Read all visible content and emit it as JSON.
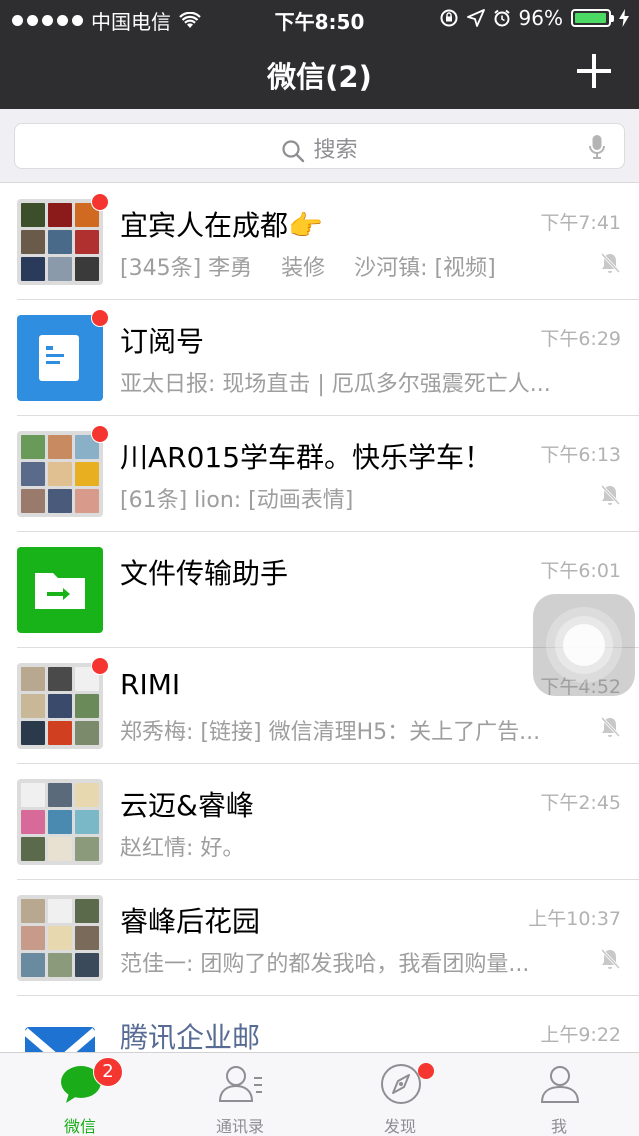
{
  "status_bar": {
    "carrier": "中国电信",
    "time": "下午8:50",
    "battery": "96%",
    "battery_level": 0.96
  },
  "nav": {
    "title": "微信(2)"
  },
  "search": {
    "placeholder": "搜索"
  },
  "chats": [
    {
      "name": "宜宾人在成都👉",
      "time": "下午7:41",
      "preview": "[345条] 李勇　 装修　 沙河镇: [视频]",
      "unread_dot": true,
      "muted": true,
      "avatar": "group"
    },
    {
      "name": "订阅号",
      "time": "下午6:29",
      "preview": "亚太日报: 现场直击 | 厄瓜多尔强震死亡人...",
      "unread_dot": true,
      "muted": false,
      "avatar": "subscription"
    },
    {
      "name": "川AR015学车群。快乐学车！",
      "time": "下午6:13",
      "preview": "[61条] lion: [动画表情]",
      "unread_dot": true,
      "muted": true,
      "avatar": "group"
    },
    {
      "name": "文件传输助手",
      "time": "下午6:01",
      "preview": "",
      "unread_dot": false,
      "muted": false,
      "avatar": "file-transfer"
    },
    {
      "name": "RIMI",
      "time": "下午4:52",
      "preview": "郑秀梅: [链接] 微信清理H5：关上了广告...",
      "unread_dot": true,
      "muted": true,
      "avatar": "group"
    },
    {
      "name": "云迈&睿峰",
      "time": "下午2:45",
      "preview": "赵红情: 好。",
      "unread_dot": false,
      "muted": false,
      "avatar": "group"
    },
    {
      "name": "睿峰后花园",
      "time": "上午10:37",
      "preview": "范佳一: 团购了的都发我哈，我看团购量...",
      "unread_dot": false,
      "muted": true,
      "avatar": "group"
    },
    {
      "name": "腾讯企业邮",
      "time": "上午9:22",
      "preview": "",
      "unread_dot": false,
      "muted": false,
      "avatar": "mail"
    }
  ],
  "tabs": [
    {
      "label": "微信",
      "badge": "2",
      "active": true
    },
    {
      "label": "通讯录"
    },
    {
      "label": "发现",
      "dot": true
    },
    {
      "label": "我"
    }
  ],
  "colors": {
    "bar_background": "#2e2e31",
    "accent_green": "#1aad19",
    "badge_red": "#f43530",
    "link_blue": "#576b95"
  }
}
